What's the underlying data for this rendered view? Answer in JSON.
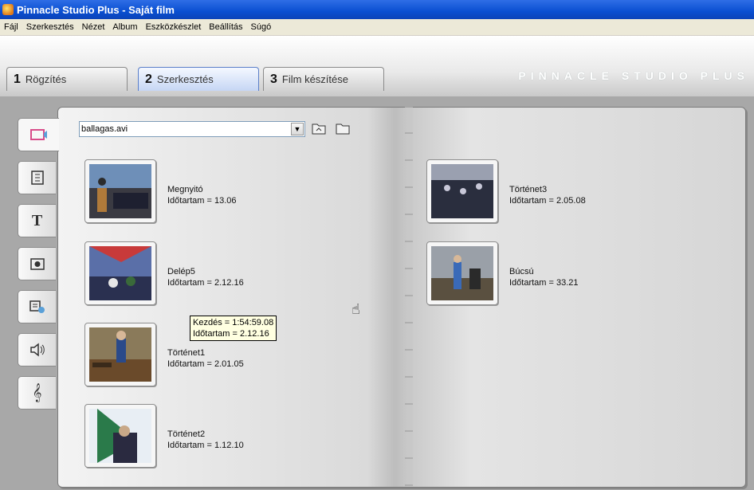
{
  "window": {
    "title": "Pinnacle Studio Plus - Saját film"
  },
  "menu": [
    "Fájl",
    "Szerkesztés",
    "Nézet",
    "Album",
    "Eszközkészlet",
    "Beállítás",
    "Súgó"
  ],
  "tabs": [
    {
      "num": "1",
      "label": "Rögzítés"
    },
    {
      "num": "2",
      "label": "Szerkesztés"
    },
    {
      "num": "3",
      "label": "Film készítése"
    }
  ],
  "brand": "PINNACLE STUDIO PLUS",
  "album": {
    "dropdown_value": "ballagas.avi"
  },
  "scenes_left": [
    {
      "title": "Megnyitó",
      "duration": "Időtartam = 13.06"
    },
    {
      "title": "Delép5",
      "duration": "Időtartam = 2.12.16"
    },
    {
      "title": "Történet1",
      "duration": "Időtartam = 2.01.05"
    },
    {
      "title": "Történet2",
      "duration": "Időtartam = 1.12.10"
    }
  ],
  "scenes_right": [
    {
      "title": "Történet3",
      "duration": "Időtartam = 2.05.08"
    },
    {
      "title": "Búcsú",
      "duration": "Időtartam = 33.21"
    }
  ],
  "tooltip": {
    "line1": "Kezdés = 1:54:59.08",
    "line2": "Időtartam = 2.12.16"
  }
}
